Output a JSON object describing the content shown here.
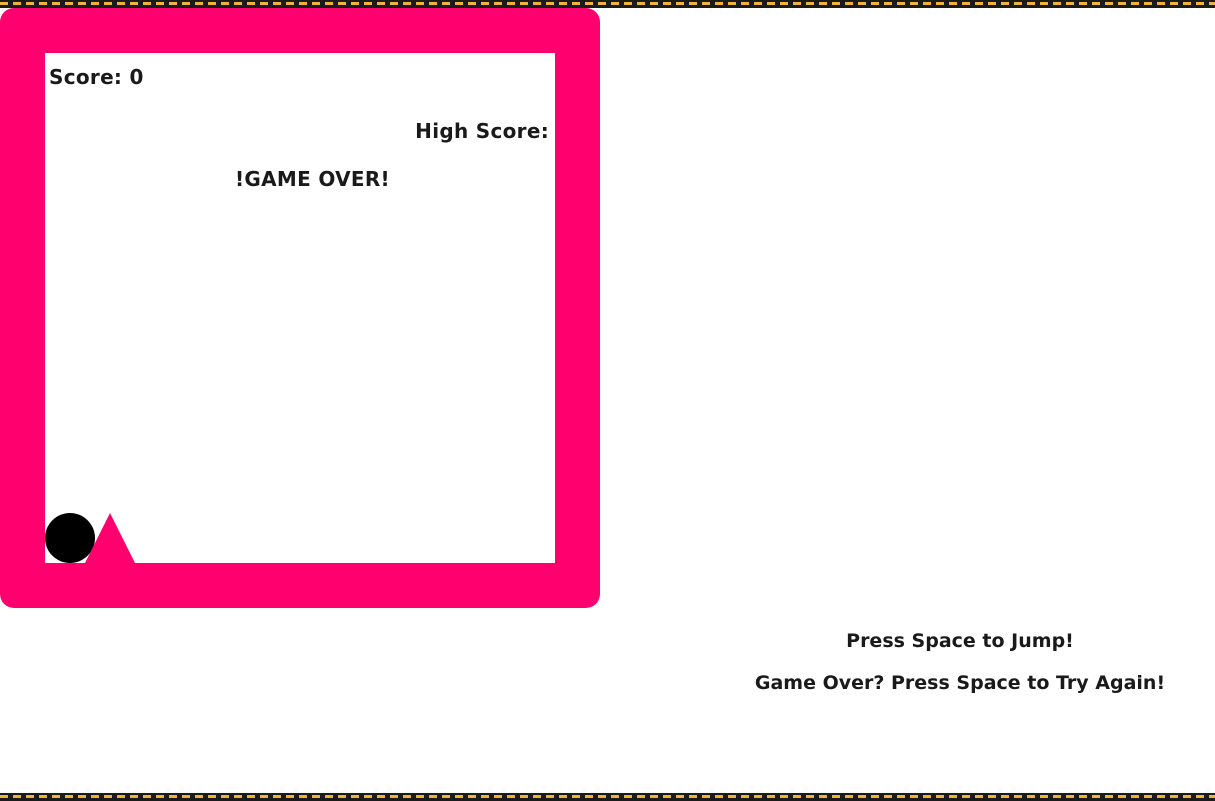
{
  "hud": {
    "score_label": "Score: 0",
    "score_value": 0,
    "high_score_label": "High Score:",
    "game_over_text": "!GAME OVER!"
  },
  "instructions": {
    "jump": "Press Space to Jump!",
    "retry": "Game Over? Press Space to Try Again!"
  },
  "colors": {
    "frame": "#ff006e",
    "canvas": "#ffffff",
    "player": "#000000",
    "obstacle": "#ff006e",
    "border": "#1b1b1b",
    "border_dashes": "#f0b43a",
    "text": "#1a1a1a"
  },
  "sprites": {
    "player": "ball",
    "obstacle": "spike-triangle"
  }
}
